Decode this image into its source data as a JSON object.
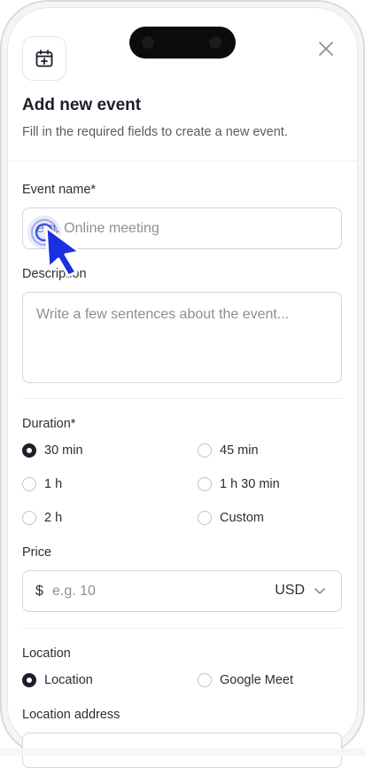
{
  "header": {
    "title": "Add new event",
    "subtitle": "Fill in the required fields to create a new event."
  },
  "event_name": {
    "label": "Event name*",
    "placeholder": "e.g. Online meeting"
  },
  "description": {
    "label": "Description",
    "placeholder": "Write a few sentences about the event..."
  },
  "duration": {
    "label": "Duration*",
    "options": [
      "30 min",
      "45 min",
      "1 h",
      "1 h 30 min",
      "2 h",
      "Custom"
    ],
    "selected": "30 min"
  },
  "price": {
    "label": "Price",
    "symbol": "$",
    "placeholder": "e.g. 10",
    "currency": "USD"
  },
  "location": {
    "label": "Location",
    "options": [
      "Location",
      "Google Meet"
    ],
    "selected": "Location"
  },
  "location_address": {
    "label": "Location address"
  },
  "colors": {
    "accent": "#1b1f2a",
    "cursor": "#1a2fe0"
  }
}
